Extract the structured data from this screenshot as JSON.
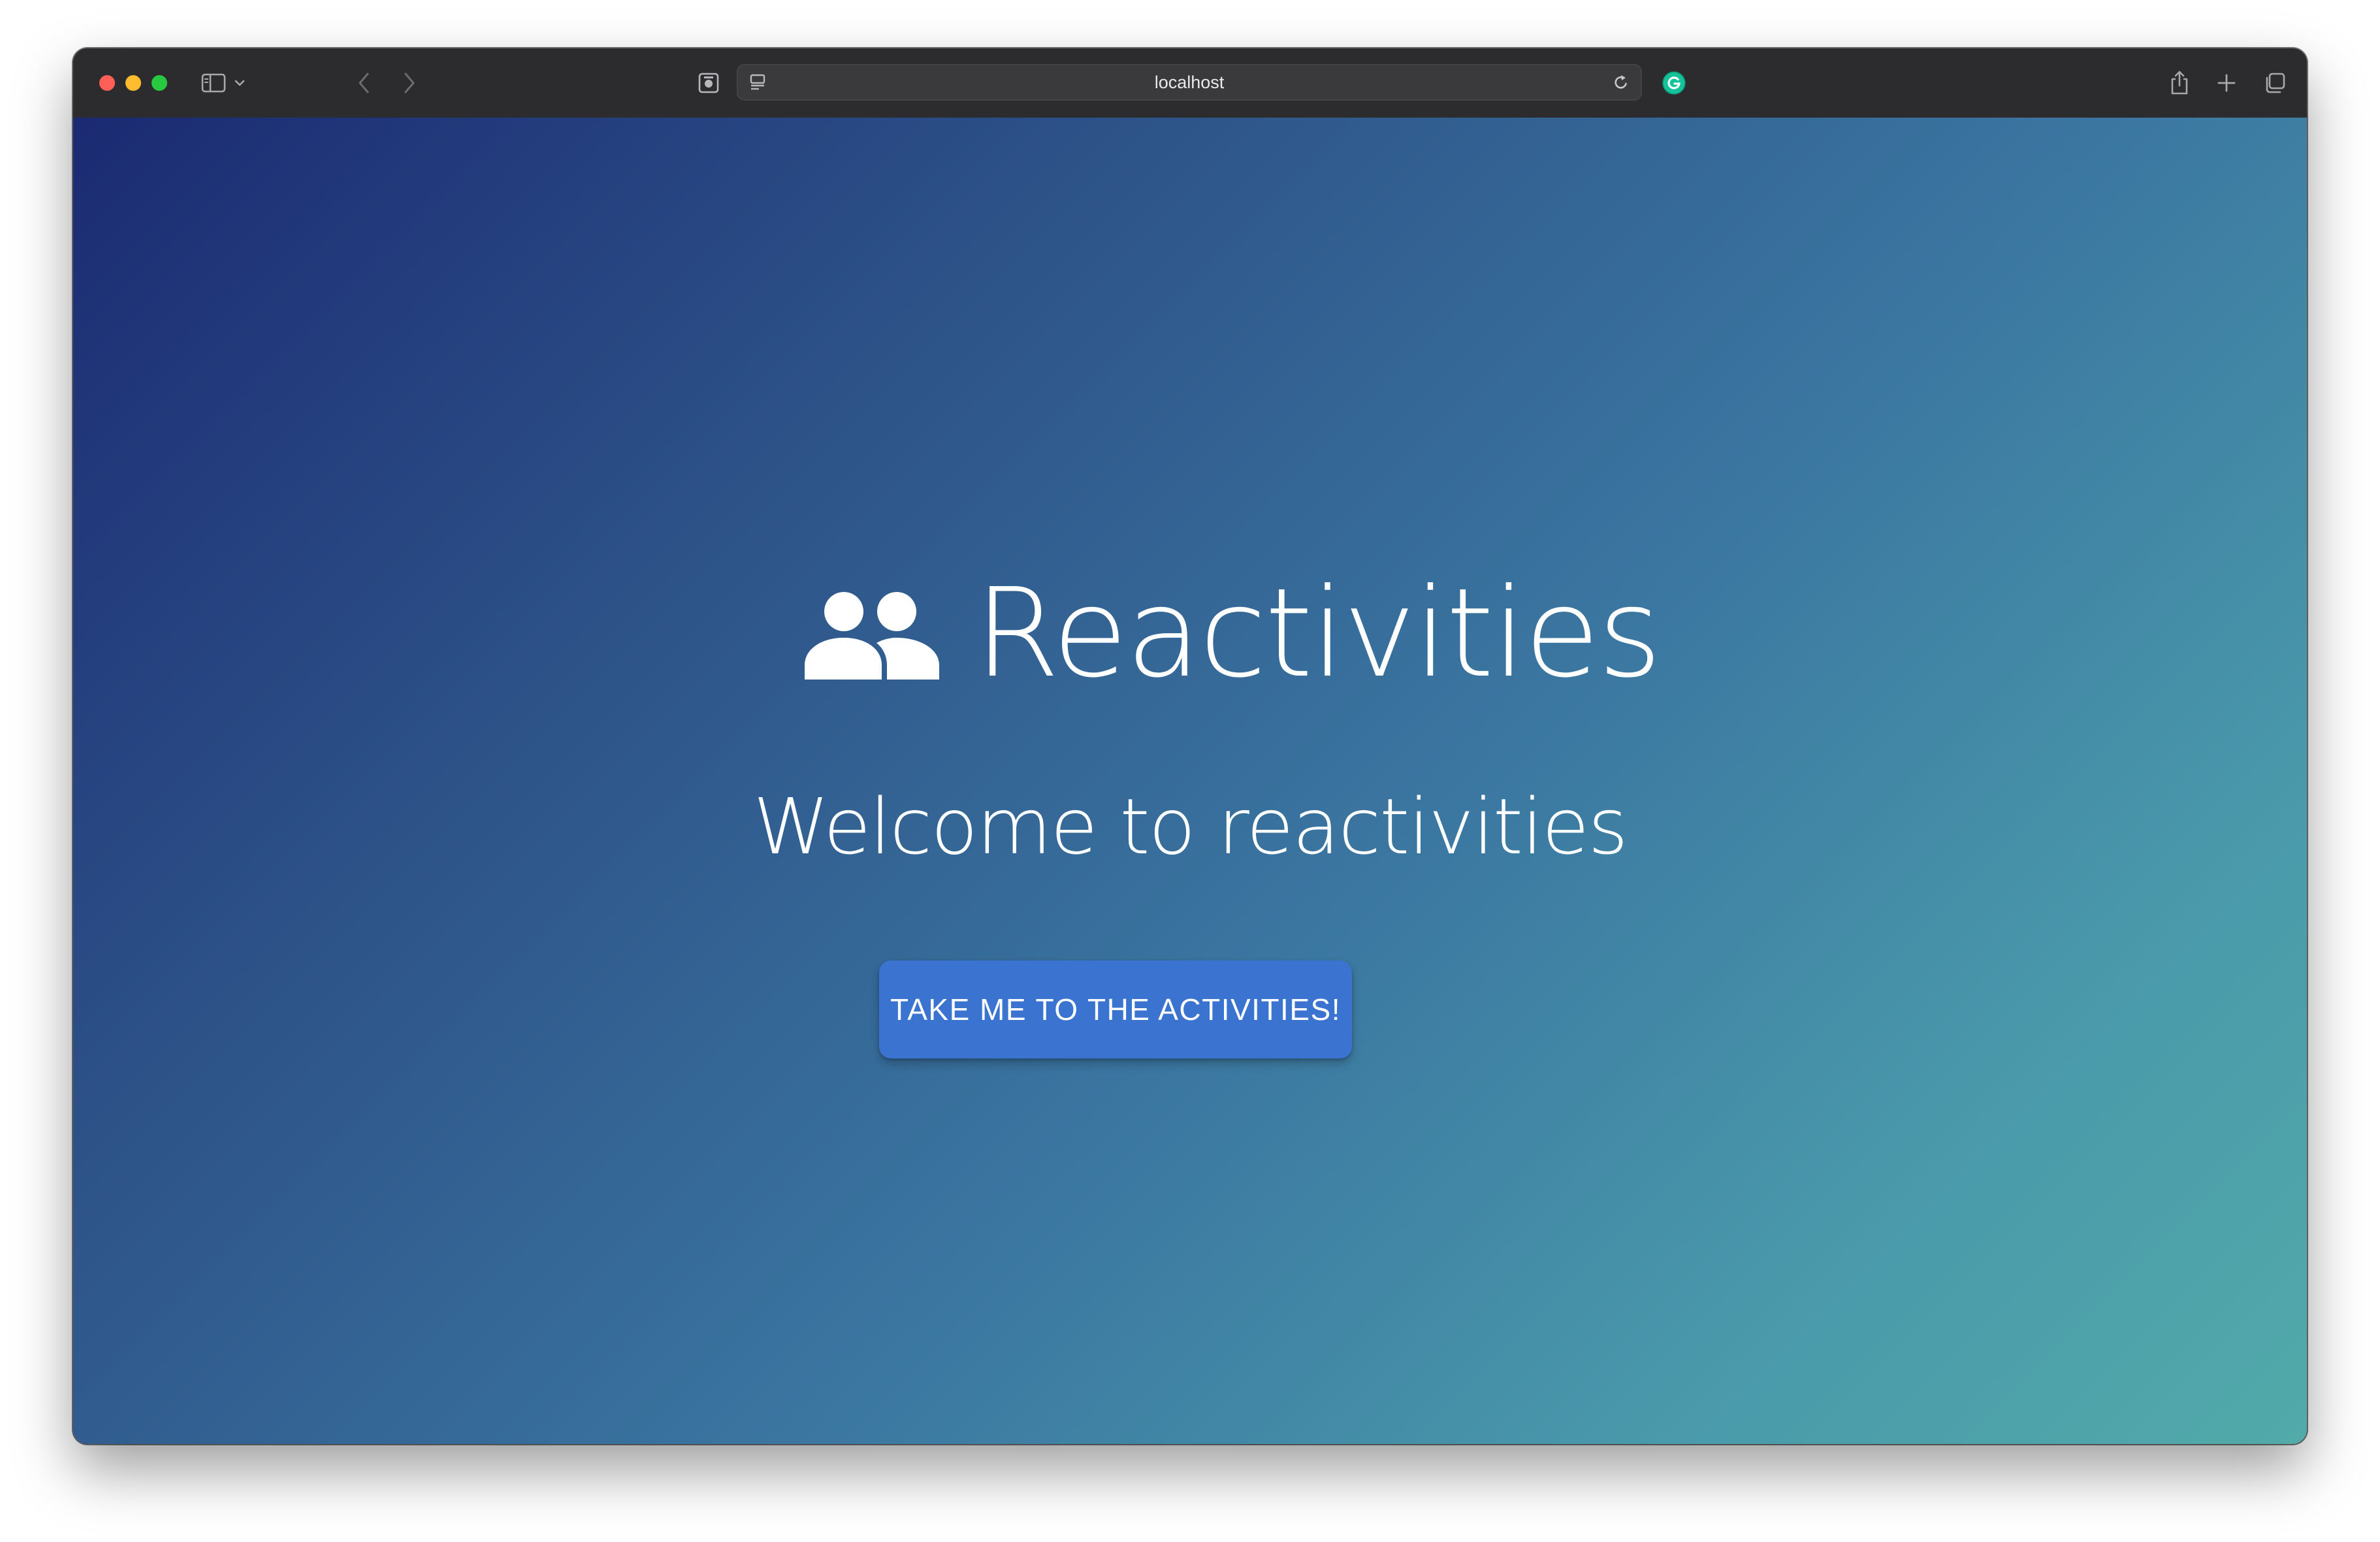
{
  "browser": {
    "address_bar": {
      "url": "localhost"
    },
    "icons": {
      "sidebar": "sidebar-icon",
      "chevron": "chevron-down-icon",
      "back": "back-arrow-icon",
      "forward": "forward-arrow-icon",
      "privacy": "privacy-report-icon",
      "reader": "reader-view-icon",
      "reload": "reload-icon",
      "extension": "grammarly-icon",
      "share": "share-icon",
      "new_tab": "plus-icon",
      "tabs": "tab-overview-icon"
    },
    "colors": {
      "close": "#fe5f57",
      "minimize": "#febc2e",
      "maximize": "#28c840",
      "extension": "#15c39a"
    }
  },
  "page": {
    "brand": {
      "icon": "group-people-icon",
      "title": "Reactivities"
    },
    "welcome_text": "Welcome to reactivities",
    "cta_label": "TAKE ME TO THE ACTIVITIES!",
    "colors": {
      "gradient_start": "#1b2a72",
      "gradient_end": "#52aaa9",
      "button": "#3a73d0",
      "text": "#ffffff"
    }
  }
}
